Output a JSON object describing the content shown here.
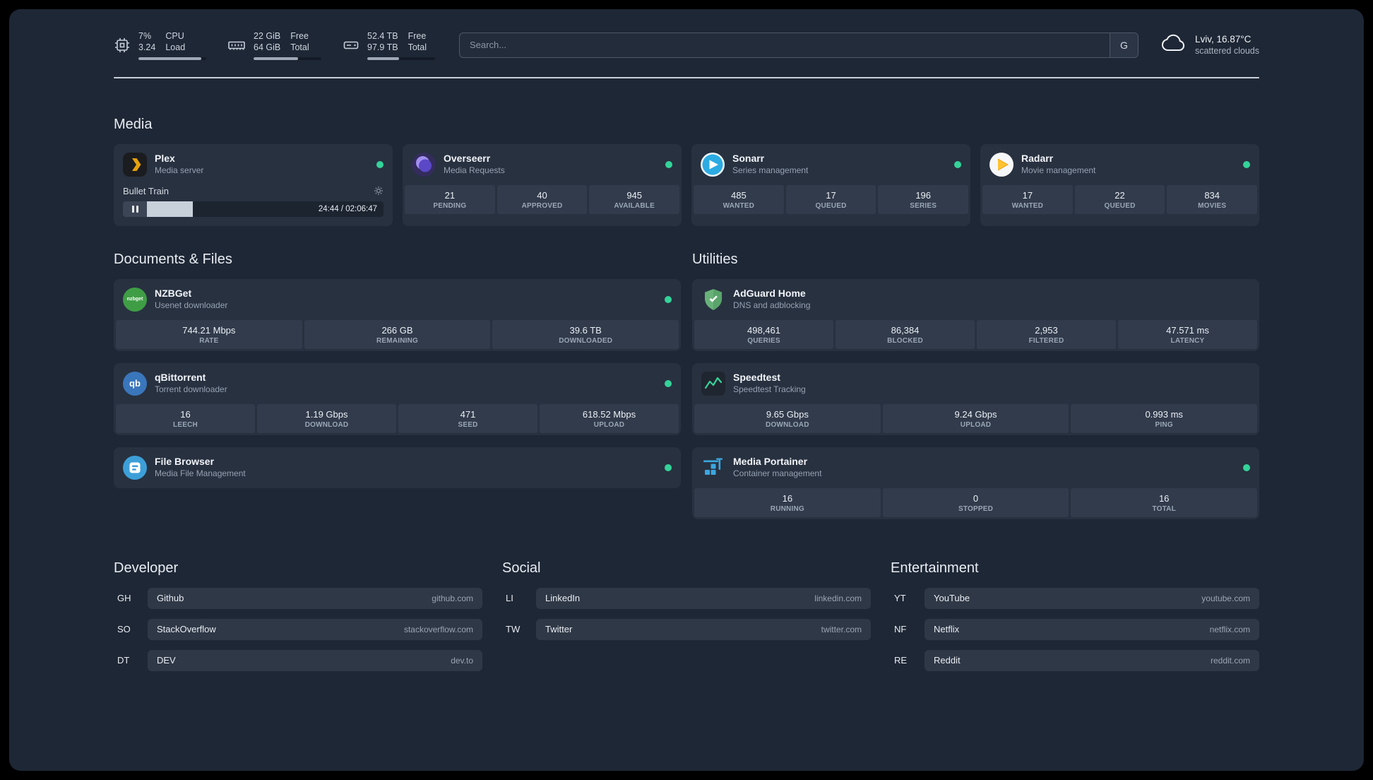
{
  "colors": {
    "status_online": "#34d399",
    "background": "#1e2735",
    "card": "#283140",
    "stat_tile": "#313b4b"
  },
  "topbar": {
    "resources": [
      {
        "icon": "cpu-icon",
        "value1": "7%",
        "value2": "3.24",
        "label1": "CPU",
        "label2": "Load",
        "progress": 93
      },
      {
        "icon": "memory-icon",
        "value1": "22 GiB",
        "value2": "64 GiB",
        "label1": "Free",
        "label2": "Total",
        "progress": 66
      },
      {
        "icon": "disk-icon",
        "value1": "52.4 TB",
        "value2": "97.9 TB",
        "label1": "Free",
        "label2": "Total",
        "progress": 47
      }
    ],
    "search": {
      "placeholder": "Search...",
      "provider_button": "G"
    },
    "weather": {
      "location": "Lviv, 16.87°C",
      "condition": "scattered clouds"
    }
  },
  "media": {
    "title": "Media",
    "cards": [
      {
        "name": "Plex",
        "desc": "Media server",
        "online": true,
        "widget": {
          "track_title": "Bullet Train",
          "time": "24:44 / 02:06:47",
          "progress": 19.5
        }
      },
      {
        "name": "Overseerr",
        "desc": "Media Requests",
        "online": true,
        "stats": [
          {
            "value": "21",
            "label": "PENDING"
          },
          {
            "value": "40",
            "label": "APPROVED"
          },
          {
            "value": "945",
            "label": "AVAILABLE"
          }
        ]
      },
      {
        "name": "Sonarr",
        "desc": "Series management",
        "online": true,
        "stats": [
          {
            "value": "485",
            "label": "WANTED"
          },
          {
            "value": "17",
            "label": "QUEUED"
          },
          {
            "value": "196",
            "label": "SERIES"
          }
        ]
      },
      {
        "name": "Radarr",
        "desc": "Movie management",
        "online": true,
        "stats": [
          {
            "value": "17",
            "label": "WANTED"
          },
          {
            "value": "22",
            "label": "QUEUED"
          },
          {
            "value": "834",
            "label": "MOVIES"
          }
        ]
      }
    ]
  },
  "documents": {
    "title": "Documents & Files",
    "cards": [
      {
        "name": "NZBGet",
        "desc": "Usenet downloader",
        "online": true,
        "icon_text": "nzbget",
        "stats": [
          {
            "value": "744.21 Mbps",
            "label": "RATE"
          },
          {
            "value": "266 GB",
            "label": "REMAINING"
          },
          {
            "value": "39.6 TB",
            "label": "DOWNLOADED"
          }
        ]
      },
      {
        "name": "qBittorrent",
        "desc": "Torrent downloader",
        "online": true,
        "icon_text": "qb",
        "stats": [
          {
            "value": "16",
            "label": "LEECH"
          },
          {
            "value": "1.19 Gbps",
            "label": "DOWNLOAD"
          },
          {
            "value": "471",
            "label": "SEED"
          },
          {
            "value": "618.52 Mbps",
            "label": "UPLOAD"
          }
        ]
      },
      {
        "name": "File Browser",
        "desc": "Media File Management",
        "online": true,
        "stats": []
      }
    ]
  },
  "utilities": {
    "title": "Utilities",
    "cards": [
      {
        "name": "AdGuard Home",
        "desc": "DNS and adblocking",
        "online": false,
        "stats": [
          {
            "value": "498,461",
            "label": "QUERIES"
          },
          {
            "value": "86,384",
            "label": "BLOCKED"
          },
          {
            "value": "2,953",
            "label": "FILTERED"
          },
          {
            "value": "47.571 ms",
            "label": "LATENCY"
          }
        ]
      },
      {
        "name": "Speedtest",
        "desc": "Speedtest Tracking",
        "online": false,
        "stats": [
          {
            "value": "9.65 Gbps",
            "label": "DOWNLOAD"
          },
          {
            "value": "9.24 Gbps",
            "label": "UPLOAD"
          },
          {
            "value": "0.993 ms",
            "label": "PING"
          }
        ]
      },
      {
        "name": "Media Portainer",
        "desc": "Container management",
        "online": true,
        "stats": [
          {
            "value": "16",
            "label": "RUNNING"
          },
          {
            "value": "0",
            "label": "STOPPED"
          },
          {
            "value": "16",
            "label": "TOTAL"
          }
        ]
      }
    ]
  },
  "bookmarks": {
    "groups": [
      {
        "title": "Developer",
        "items": [
          {
            "abbr": "GH",
            "name": "Github",
            "domain": "github.com"
          },
          {
            "abbr": "SO",
            "name": "StackOverflow",
            "domain": "stackoverflow.com"
          },
          {
            "abbr": "DT",
            "name": "DEV",
            "domain": "dev.to"
          }
        ]
      },
      {
        "title": "Social",
        "items": [
          {
            "abbr": "LI",
            "name": "LinkedIn",
            "domain": "linkedin.com"
          },
          {
            "abbr": "TW",
            "name": "Twitter",
            "domain": "twitter.com"
          }
        ]
      },
      {
        "title": "Entertainment",
        "items": [
          {
            "abbr": "YT",
            "name": "YouTube",
            "domain": "youtube.com"
          },
          {
            "abbr": "NF",
            "name": "Netflix",
            "domain": "netflix.com"
          },
          {
            "abbr": "RE",
            "name": "Reddit",
            "domain": "reddit.com"
          }
        ]
      }
    ]
  }
}
